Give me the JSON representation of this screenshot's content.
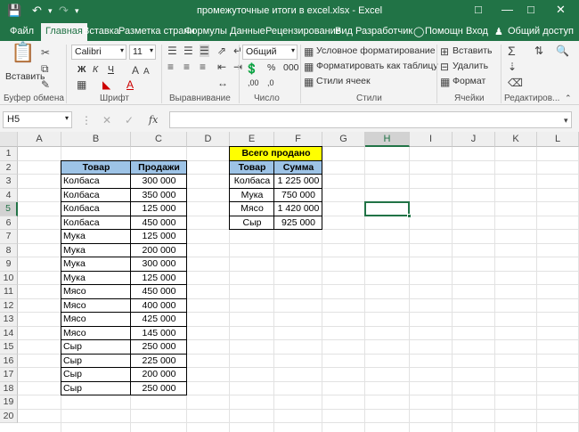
{
  "title": "промежуточные итоги в excel.xlsx - Excel",
  "tabs": [
    "Файл",
    "Главная",
    "Вставка",
    "Разметка страни",
    "Формулы",
    "Данные",
    "Рецензирование",
    "Вид",
    "Разработчик"
  ],
  "help_label": "Помощн",
  "signin_label": "Вход",
  "share_label": "Общий доступ",
  "ribbon": {
    "paste_label": "Вставить",
    "font_name": "Calibri",
    "font_size": "11",
    "number_format": "Общий",
    "cond_format": "Условное форматирование",
    "format_table": "Форматировать как таблицу",
    "cell_styles": "Стили ячеек",
    "insert": "Вставить",
    "delete": "Удалить",
    "format": "Формат",
    "groups": [
      "Буфер обмена",
      "Шрифт",
      "Выравнивание",
      "Число",
      "Стили",
      "Ячейки",
      "Редактиров..."
    ]
  },
  "name_box": "H5",
  "fx": "fx",
  "columns": [
    "A",
    "B",
    "C",
    "D",
    "E",
    "F",
    "G",
    "H",
    "I",
    "J",
    "K",
    "L"
  ],
  "rows": [
    "1",
    "2",
    "3",
    "4",
    "5",
    "6",
    "7",
    "8",
    "9",
    "10",
    "11",
    "12",
    "13",
    "14",
    "15",
    "16",
    "17",
    "18",
    "19",
    "20"
  ],
  "table1": {
    "headers": [
      "Товар",
      "Продажи"
    ],
    "rows": [
      [
        "Колбаса",
        "300 000"
      ],
      [
        "Колбаса",
        "350 000"
      ],
      [
        "Колбаса",
        "125 000"
      ],
      [
        "Колбаса",
        "450 000"
      ],
      [
        "Мука",
        "125 000"
      ],
      [
        "Мука",
        "200 000"
      ],
      [
        "Мука",
        "300 000"
      ],
      [
        "Мука",
        "125 000"
      ],
      [
        "Мясо",
        "450 000"
      ],
      [
        "Мясо",
        "400 000"
      ],
      [
        "Мясо",
        "425 000"
      ],
      [
        "Мясо",
        "145 000"
      ],
      [
        "Сыр",
        "250 000"
      ],
      [
        "Сыр",
        "225 000"
      ],
      [
        "Сыр",
        "200 000"
      ],
      [
        "Сыр",
        "250 000"
      ]
    ]
  },
  "table2": {
    "title": "Всего продано",
    "headers": [
      "Товар",
      "Сумма"
    ],
    "rows": [
      [
        "Колбаса",
        "1 225 000"
      ],
      [
        "Мука",
        "750 000"
      ],
      [
        "Мясо",
        "1 420 000"
      ],
      [
        "Сыр",
        "925 000"
      ]
    ]
  },
  "colors": {
    "excel_green": "#217346",
    "header_blue": "#9dc3e6",
    "title_yellow": "#ffff00"
  }
}
